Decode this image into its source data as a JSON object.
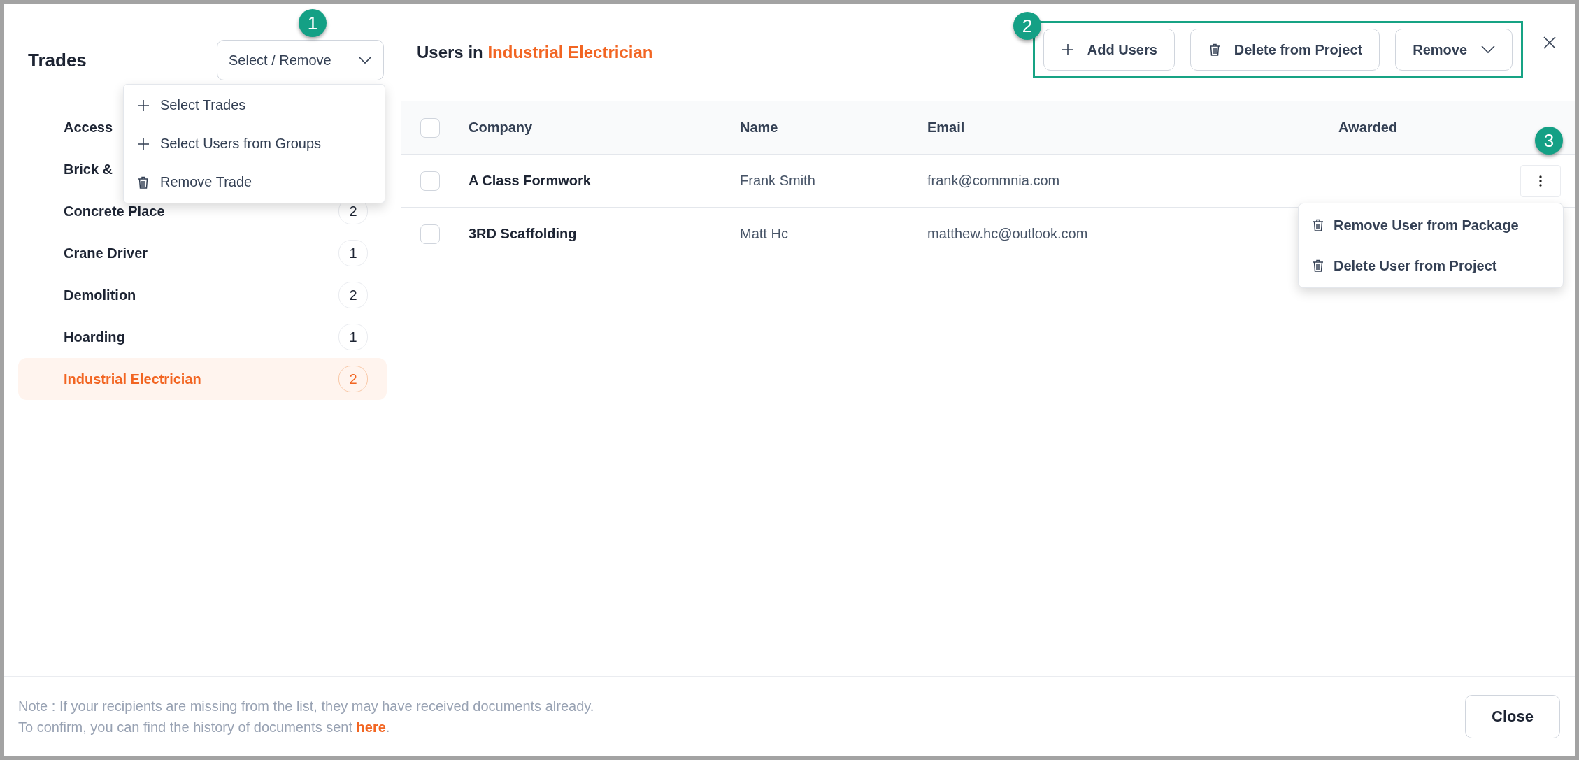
{
  "trades_panel": {
    "title": "Trades",
    "menu_button": "Select / Remove",
    "menu": [
      {
        "kind": "add",
        "label": "Select Trades"
      },
      {
        "kind": "add",
        "label": "Select Users from Groups"
      },
      {
        "kind": "delete",
        "label": "Remove Trade"
      }
    ],
    "trades": [
      {
        "name": "Access",
        "selected": false
      },
      {
        "name": "Brick &",
        "selected": false
      },
      {
        "name": "Concrete Place",
        "count": "2",
        "selected": false
      },
      {
        "name": "Crane Driver",
        "count": "1",
        "selected": false
      },
      {
        "name": "Demolition",
        "count": "2",
        "selected": false
      },
      {
        "name": "Hoarding",
        "count": "1",
        "selected": false
      },
      {
        "name": "Industrial Electrician",
        "count": "2",
        "selected": true
      }
    ]
  },
  "users_panel": {
    "title": "Users in",
    "trade": "Industrial Electrician",
    "actions": [
      {
        "kind": "add",
        "label": "Add Users"
      },
      {
        "kind": "delete",
        "label": "Delete from Project"
      },
      {
        "kind": "dropdown",
        "label": "Remove"
      }
    ],
    "table": {
      "columns": [
        "Company",
        "Name",
        "Email",
        "Awarded"
      ],
      "all_checked": false,
      "rows": [
        {
          "company": "A Class Formwork",
          "name": "Frank Smith",
          "email": "frank@commnia.com",
          "checked": false,
          "menu_open": true
        },
        {
          "company": "3RD Scaffolding",
          "name": "Matt Hc",
          "email": "matthew.hc@outlook.com",
          "checked": false,
          "menu_open": false
        }
      ]
    },
    "row_menu": [
      "Remove User from Package",
      "Delete User from Project"
    ]
  },
  "annotations": [
    "1",
    "2",
    "3"
  ],
  "footer": {
    "note": "Note : If your recipients are missing from the list, they may have received documents already.",
    "note_2": "To confirm, you can find the history of documents sent ",
    "link": "here",
    "note_2_end": ".",
    "close_button": "Close"
  }
}
